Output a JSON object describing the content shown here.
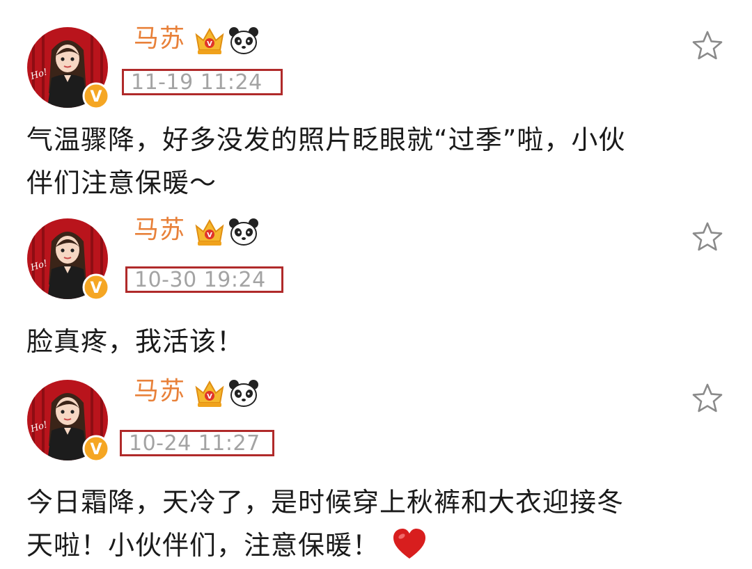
{
  "posts": [
    {
      "username": "马苏",
      "timestamp": "11-19 11:24",
      "lines": [
        "气温骤降，好多没发的照片眨眼就“过季”啦，小伙",
        "伴们注意保暖～"
      ]
    },
    {
      "username": "马苏",
      "timestamp": "10-30 19:24",
      "lines": [
        "脸真疼，我活该！"
      ]
    },
    {
      "username": "马苏",
      "timestamp": "10-24 11:27",
      "lines": [
        "今日霜降，天冷了，是时候穿上秋裤和大衣迎接冬",
        "天啦！小伙伴们，注意保暖！"
      ]
    }
  ],
  "avatar_sign": "Ho!",
  "verified_badge": "V",
  "icons": {
    "vip": "crown-icon",
    "badge": "panda-icon",
    "favorite": "star-icon",
    "emoji": "heart-icon"
  },
  "colors": {
    "username": "#e8813a",
    "timestamp": "#a3a3a3",
    "highlight_box": "#b02a2a",
    "text": "#1a1a1a",
    "verified": "#f5a623",
    "heart": "#d81e1e"
  }
}
